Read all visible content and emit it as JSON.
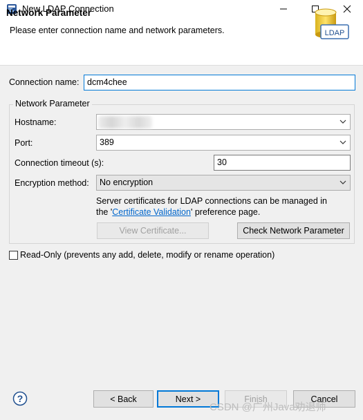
{
  "window": {
    "title": "New LDAP Connection",
    "icon": "eclipse-window-icon",
    "controls": [
      "minimize-icon",
      "maximize-icon",
      "close-icon"
    ]
  },
  "banner": {
    "title": "Network Parameter",
    "description": "Please enter connection name and network parameters.",
    "badge_text": "LDAP"
  },
  "form": {
    "connection_name_label": "Connection name:",
    "connection_name_value": "dcm4chee",
    "group_label": "Network Parameter",
    "hostname_label": "Hostname:",
    "hostname_value": "",
    "port_label": "Port:",
    "port_value": "389",
    "timeout_label": "Connection timeout (s):",
    "timeout_value": "30",
    "encryption_label": "Encryption method:",
    "encryption_value": "No encryption",
    "cert_info_line1": "Server certificates for LDAP connections can be managed in",
    "cert_info_prefix": "the '",
    "cert_info_link": "Certificate Validation",
    "cert_info_suffix": "' preference page.",
    "view_certificate_button": "View Certificate...",
    "check_network_button": "Check Network Parameter",
    "readonly_label": "Read-Only (prevents any add, delete, modify or rename operation)",
    "readonly_checked": false
  },
  "footer": {
    "help_icon": "help-icon",
    "back_button": "< Back",
    "next_button": "Next >",
    "finish_button": "Finish",
    "cancel_button": "Cancel",
    "watermark": "CSDN @广州Java劝退师"
  },
  "colors": {
    "accent": "#0078d7",
    "link": "#0066cc",
    "dialog_bg": "#f0f0f0"
  }
}
